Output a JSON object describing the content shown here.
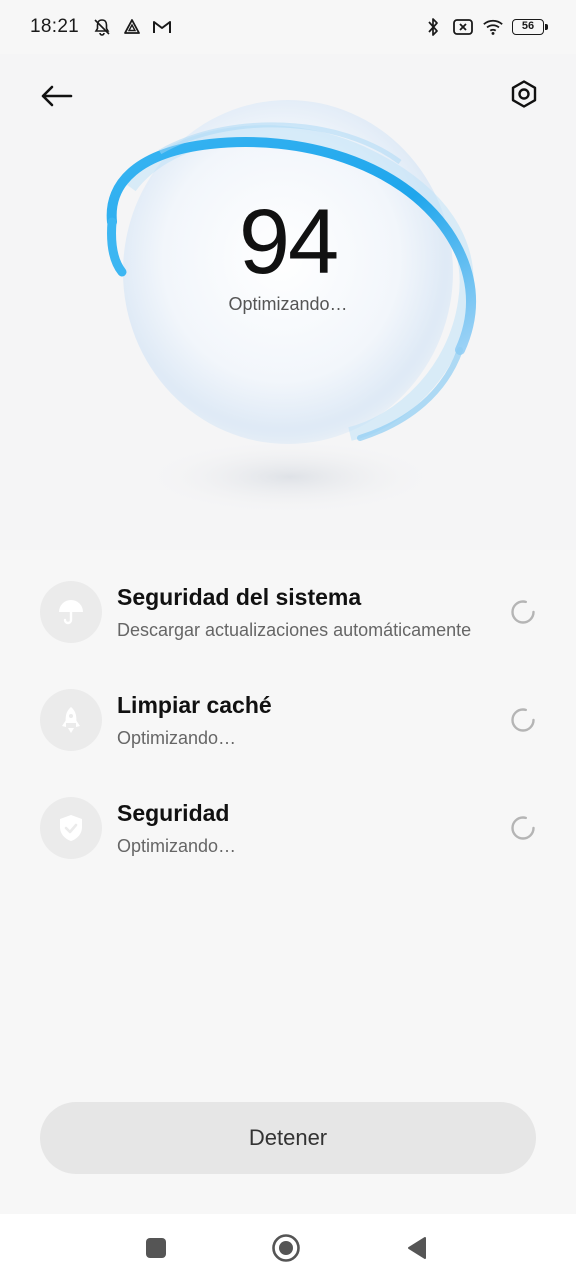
{
  "status_bar": {
    "time": "18:21",
    "battery": "56",
    "left_icons": [
      "bell-off-icon",
      "triangle-app-icon",
      "gmail-icon"
    ],
    "right_icons": [
      "bluetooth-icon",
      "no-sim-icon",
      "wifi-icon",
      "battery-icon"
    ]
  },
  "header": {
    "back_icon": "back-arrow-icon",
    "settings_icon": "settings-hex-icon"
  },
  "score": {
    "value": "94",
    "status": "Optimizando…"
  },
  "items": [
    {
      "title": "Seguridad del sistema",
      "subtitle": "Descargar actualizaciones automáticamente",
      "icon": "umbrella-icon"
    },
    {
      "title": "Limpiar caché",
      "subtitle": "Optimizando…",
      "icon": "rocket-icon"
    },
    {
      "title": "Seguridad",
      "subtitle": "Optimizando…",
      "icon": "shield-check-icon"
    }
  ],
  "stop_button": {
    "label": "Detener"
  },
  "nav": {
    "icons": [
      "recents-square-icon",
      "home-circle-icon",
      "back-triangle-icon"
    ]
  },
  "colors": {
    "accent_blue": "#2aa8ee",
    "background": "#f7f7f7",
    "button_gray": "#e6e6e6"
  }
}
